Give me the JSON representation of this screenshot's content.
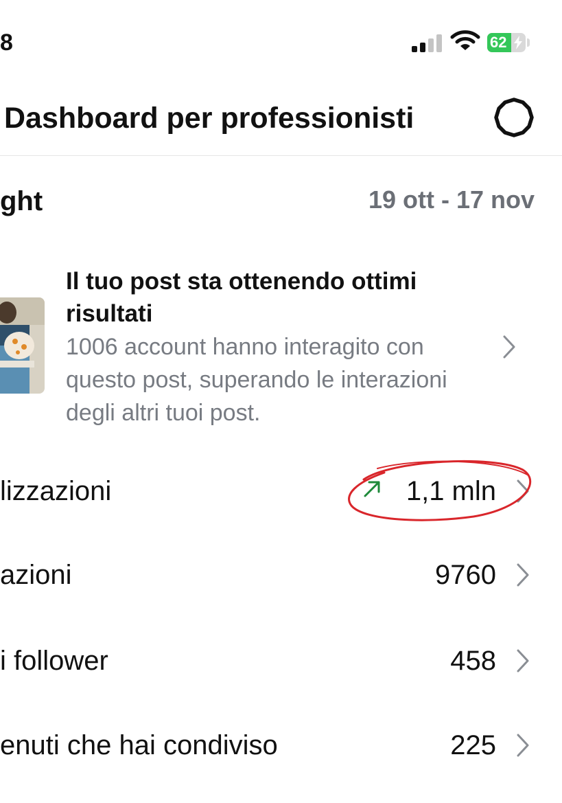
{
  "status_bar": {
    "time": "8",
    "battery_level": "62",
    "icons": [
      "cellular-signal-icon",
      "wifi-icon",
      "battery-charging-icon"
    ],
    "battery_color": "#34c759"
  },
  "header": {
    "title": "Dashboard per professionisti",
    "settings_icon": "gear-icon"
  },
  "insights": {
    "title": "ght",
    "date_range": "19 ott - 17 nov"
  },
  "post_card": {
    "title": "Il tuo post sta ottenendo ottimi risultati",
    "body": "1006 account hanno interagito con questo post, superando le interazioni degli altri tuoi post."
  },
  "metrics": [
    {
      "label": "lizzazioni",
      "value": "1,1 mln",
      "trend": "up",
      "trend_color": "#1e8a3a",
      "highlighted": true
    },
    {
      "label": "azioni",
      "value": "9760"
    },
    {
      "label": "i follower",
      "value": "458"
    },
    {
      "label": "enuti che hai condiviso",
      "value": "225"
    }
  ],
  "colors": {
    "secondary_text": "#777b82",
    "annotation_red": "#d9262b",
    "chevron": "#8a8e94"
  }
}
